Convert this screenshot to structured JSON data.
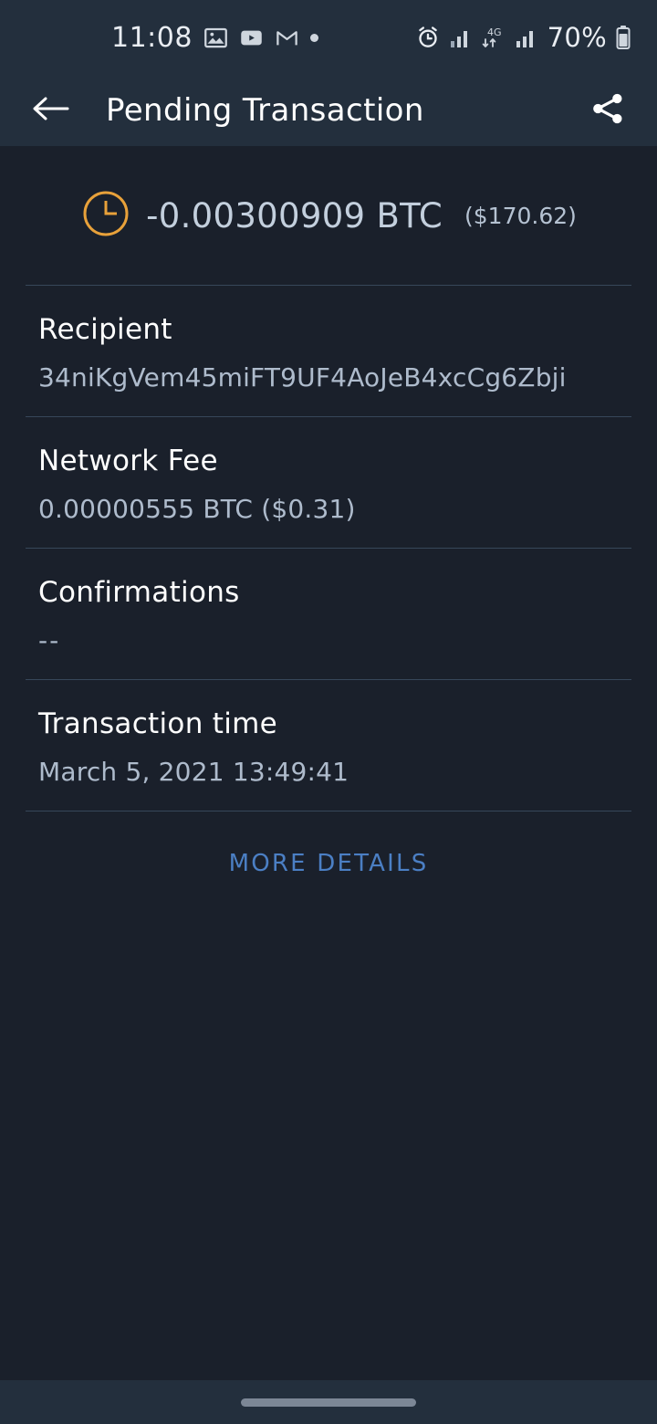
{
  "status_bar": {
    "time": "11:08",
    "notification_icons": [
      "gallery-icon",
      "youtube-icon",
      "gmail-icon",
      "dot-icon"
    ],
    "right_icons": [
      "alarm-icon",
      "signal-bars-icon",
      "4g-data-icon",
      "signal-bars-icon"
    ],
    "network_label": "4G",
    "battery_percent": "70%"
  },
  "app_bar": {
    "back_icon": "back-arrow-icon",
    "title": "Pending Transaction",
    "share_icon": "share-icon"
  },
  "transaction": {
    "status_icon": "pending-clock-icon",
    "amount_btc": "-0.00300909 BTC",
    "amount_fiat": "($170.62)",
    "fields": [
      {
        "label": "Recipient",
        "value": "34niKgVem45miFT9UF4AoJeB4xcCg6Zbji"
      },
      {
        "label": "Network Fee",
        "value": "0.00000555 BTC ($0.31)"
      },
      {
        "label": "Confirmations",
        "value": "--"
      },
      {
        "label": "Transaction time",
        "value": "March 5, 2021 13:49:41"
      }
    ],
    "more_details_label": "MORE DETAILS"
  },
  "colors": {
    "background": "#1a202b",
    "bar_background": "#232f3d",
    "pending_accent": "#e8a13a",
    "link": "#4b7fc4",
    "value_text": "#aebbcc",
    "divider": "#37475a"
  },
  "nav_bar": {
    "home_indicator": "home-indicator"
  }
}
